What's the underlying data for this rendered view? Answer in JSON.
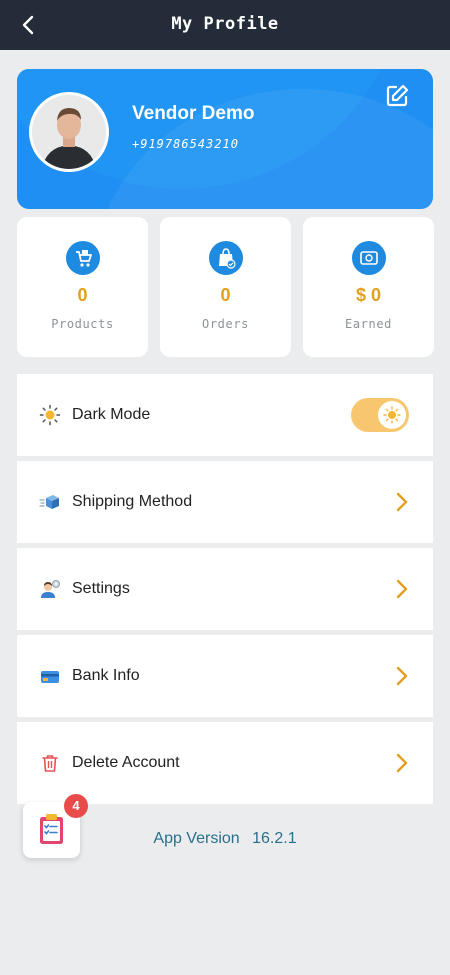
{
  "header": {
    "title": "My Profile",
    "back_icon": "back-arrow-icon"
  },
  "profile": {
    "name": "Vendor Demo",
    "phone": "+919786543210",
    "edit_icon": "edit-icon",
    "card_color": "#1f8ff3"
  },
  "stats": [
    {
      "value": "0",
      "label": "Products",
      "icon": "cart-icon"
    },
    {
      "value": "0",
      "label": "Orders",
      "icon": "shopping-bag-icon"
    },
    {
      "value": "$ 0",
      "label": "Earned",
      "icon": "money-icon"
    }
  ],
  "menu": {
    "dark_mode": {
      "label": "Dark Mode",
      "icon": "sun-icon",
      "toggle_on": true
    },
    "shipping": {
      "label": "Shipping Method",
      "icon": "box-icon"
    },
    "settings": {
      "label": "Settings",
      "icon": "user-settings-icon"
    },
    "bank": {
      "label": "Bank Info",
      "icon": "card-icon"
    },
    "delete": {
      "label": "Delete Account",
      "icon": "trash-icon"
    }
  },
  "footer": {
    "version_label": "App Version",
    "version_number": "16.2.1"
  },
  "fab": {
    "badge_count": "4",
    "icon": "clipboard-icon"
  },
  "colors": {
    "accent": "#e3a020",
    "topbar": "#232c38",
    "badge": "#e94b4b"
  }
}
